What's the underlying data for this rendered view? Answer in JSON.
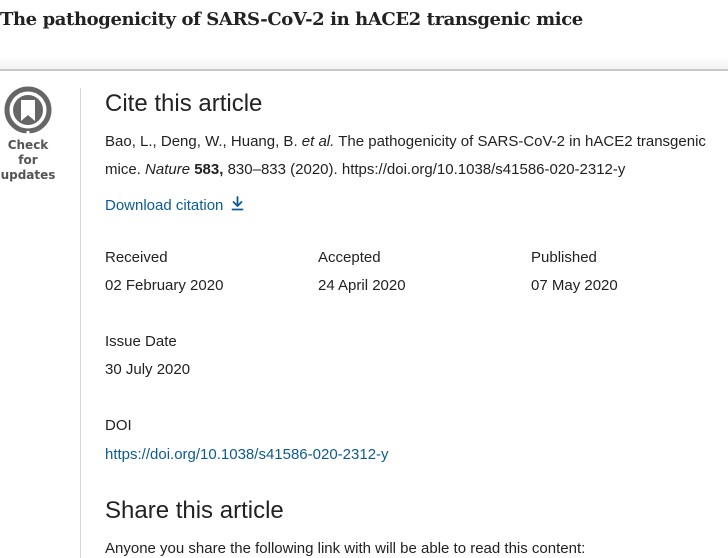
{
  "article": {
    "title": "The pathogenicity of SARS-CoV-2 in hACE2 transgenic mice"
  },
  "badge": {
    "icon": "check-for-updates-icon",
    "label": "Check for\nupdates"
  },
  "cite": {
    "heading": "Cite this article",
    "authors": "Bao, L., Deng, W., Huang, B.",
    "et_al": "et al.",
    "title_text": "The pathogenicity of SARS-CoV-2 in hACE2 transgenic mice.",
    "journal": "Nature",
    "volume": "583,",
    "pages_year": "830–833 (2020).",
    "doi_url": "https://doi.org/10.1038/s41586-020-2312-y",
    "download_label": "Download citation",
    "download_icon": "download-icon"
  },
  "dates": {
    "received_label": "Received",
    "received_value": "02 February 2020",
    "accepted_label": "Accepted",
    "accepted_value": "24 April 2020",
    "published_label": "Published",
    "published_value": "07 May 2020",
    "issue_label": "Issue Date",
    "issue_value": "30 July 2020"
  },
  "doi": {
    "label": "DOI",
    "value": "https://doi.org/10.1038/s41586-020-2312-y"
  },
  "share": {
    "heading": "Share this article",
    "text": "Anyone you share the following link with will be able to read this content:"
  },
  "colors": {
    "link": "#0c5c8e",
    "text": "#222222",
    "badge": "#555555"
  }
}
